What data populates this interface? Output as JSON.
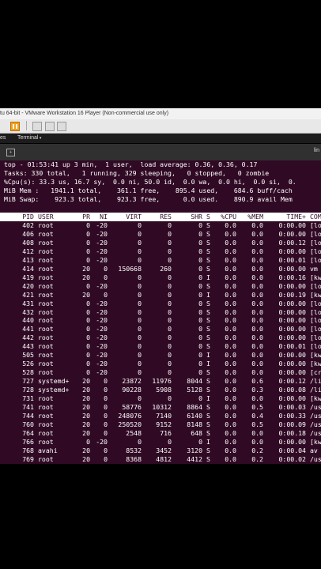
{
  "window": {
    "title": "tu 64-bit - VMware Workstation 16 Player (Non-commercial use only)"
  },
  "gnome": {
    "activities": "es",
    "app": "Terminal"
  },
  "terminal_header": {
    "title": "lin"
  },
  "summary": [
    "top - 01:53:41 up 3 min,  1 user,  load average: 0.36, 0.36, 0.17",
    "Tasks: 330 total,   1 running, 329 sleeping,   0 stopped,   0 zombie",
    "%Cpu(s): 33.3 us, 16.7 sy,  0.0 ni, 50.0 id,  0.0 wa,  0.0 hi,  0.0 si,  0.",
    "MiB Mem :   1941.1 total,    361.1 free,    895.4 used,    684.6 buff/cach",
    "MiB Swap:    923.3 total,    923.3 free,      0.0 used.    890.9 avail Mem"
  ],
  "columns": [
    "PID",
    "USER",
    "PR",
    "NI",
    "VIRT",
    "RES",
    "SHR",
    "S",
    "%CPU",
    "%MEM",
    "TIME+",
    "COM"
  ],
  "processes": [
    [
      "402",
      "root",
      "0",
      "-20",
      "0",
      "0",
      "0",
      "S",
      "0.0",
      "0.0",
      "0:00.00",
      "[lo"
    ],
    [
      "406",
      "root",
      "0",
      "-20",
      "0",
      "0",
      "0",
      "S",
      "0.0",
      "0.0",
      "0:00.00",
      "[lo"
    ],
    [
      "408",
      "root",
      "0",
      "-20",
      "0",
      "0",
      "0",
      "S",
      "0.0",
      "0.0",
      "0:00.12",
      "[lo"
    ],
    [
      "412",
      "root",
      "0",
      "-20",
      "0",
      "0",
      "0",
      "S",
      "0.0",
      "0.0",
      "0:00.00",
      "[lo"
    ],
    [
      "413",
      "root",
      "0",
      "-20",
      "0",
      "0",
      "0",
      "S",
      "0.0",
      "0.0",
      "0:00.01",
      "[lo"
    ],
    [
      "414",
      "root",
      "20",
      "0",
      "150668",
      "260",
      "0",
      "S",
      "0.0",
      "0.0",
      "0:00.00",
      "vm"
    ],
    [
      "419",
      "root",
      "20",
      "0",
      "0",
      "0",
      "0",
      "I",
      "0.0",
      "0.0",
      "0:00.16",
      "[kw"
    ],
    [
      "420",
      "root",
      "0",
      "-20",
      "0",
      "0",
      "0",
      "S",
      "0.0",
      "0.0",
      "0:00.00",
      "[lo"
    ],
    [
      "421",
      "root",
      "20",
      "0",
      "0",
      "0",
      "0",
      "I",
      "0.0",
      "0.0",
      "0:00.19",
      "[kw"
    ],
    [
      "431",
      "root",
      "0",
      "-20",
      "0",
      "0",
      "0",
      "S",
      "0.0",
      "0.0",
      "0:00.00",
      "[lo"
    ],
    [
      "432",
      "root",
      "0",
      "-20",
      "0",
      "0",
      "0",
      "S",
      "0.0",
      "0.0",
      "0:00.00",
      "[lo"
    ],
    [
      "440",
      "root",
      "0",
      "-20",
      "0",
      "0",
      "0",
      "S",
      "0.0",
      "0.0",
      "0:00.00",
      "[lo"
    ],
    [
      "441",
      "root",
      "0",
      "-20",
      "0",
      "0",
      "0",
      "S",
      "0.0",
      "0.0",
      "0:00.00",
      "[lo"
    ],
    [
      "442",
      "root",
      "0",
      "-20",
      "0",
      "0",
      "0",
      "S",
      "0.0",
      "0.0",
      "0:00.00",
      "[lo"
    ],
    [
      "443",
      "root",
      "0",
      "-20",
      "0",
      "0",
      "0",
      "S",
      "0.0",
      "0.0",
      "0:00.01",
      "[lo"
    ],
    [
      "505",
      "root",
      "0",
      "-20",
      "0",
      "0",
      "0",
      "I",
      "0.0",
      "0.0",
      "0:00.00",
      "[kw"
    ],
    [
      "526",
      "root",
      "0",
      "-20",
      "0",
      "0",
      "0",
      "I",
      "0.0",
      "0.0",
      "0:00.00",
      "[kw"
    ],
    [
      "528",
      "root",
      "0",
      "-20",
      "0",
      "0",
      "0",
      "S",
      "0.0",
      "0.0",
      "0:00.00",
      "[cr"
    ],
    [
      "727",
      "systemd+",
      "20",
      "0",
      "23872",
      "11976",
      "8044",
      "S",
      "0.0",
      "0.6",
      "0:00.12",
      "/li"
    ],
    [
      "728",
      "systemd+",
      "20",
      "0",
      "90228",
      "5908",
      "5128",
      "S",
      "0.0",
      "0.3",
      "0:00.08",
      "/li"
    ],
    [
      "731",
      "root",
      "20",
      "0",
      "0",
      "0",
      "0",
      "I",
      "0.0",
      "0.0",
      "0:00.00",
      "[kw"
    ],
    [
      "741",
      "root",
      "20",
      "0",
      "58776",
      "10312",
      "8864",
      "S",
      "0.0",
      "0.5",
      "0:00.03",
      "/us"
    ],
    [
      "744",
      "root",
      "20",
      "0",
      "248076",
      "7140",
      "6140",
      "S",
      "0.0",
      "0.4",
      "0:00.33",
      "/us"
    ],
    [
      "760",
      "root",
      "20",
      "0",
      "250520",
      "9152",
      "8148",
      "S",
      "0.0",
      "0.5",
      "0:00.09",
      "/us"
    ],
    [
      "764",
      "root",
      "20",
      "0",
      "2548",
      "716",
      "648",
      "S",
      "0.0",
      "0.0",
      "0:00.18",
      "/us"
    ],
    [
      "766",
      "root",
      "0",
      "-20",
      "0",
      "0",
      "0",
      "I",
      "0.0",
      "0.0",
      "0:00.00",
      "[kw"
    ],
    [
      "768",
      "avahi",
      "20",
      "0",
      "8532",
      "3452",
      "3120",
      "S",
      "0.0",
      "0.2",
      "0:00.04",
      "av"
    ],
    [
      "769",
      "root",
      "20",
      "0",
      "8368",
      "4812",
      "4412",
      "S",
      "0.0",
      "0.2",
      "0:00.02",
      "/us"
    ]
  ],
  "colors": {
    "terminal_bg": "#300a24",
    "header_bg": "#ffffff",
    "scrollbar": "#5a2a48"
  }
}
